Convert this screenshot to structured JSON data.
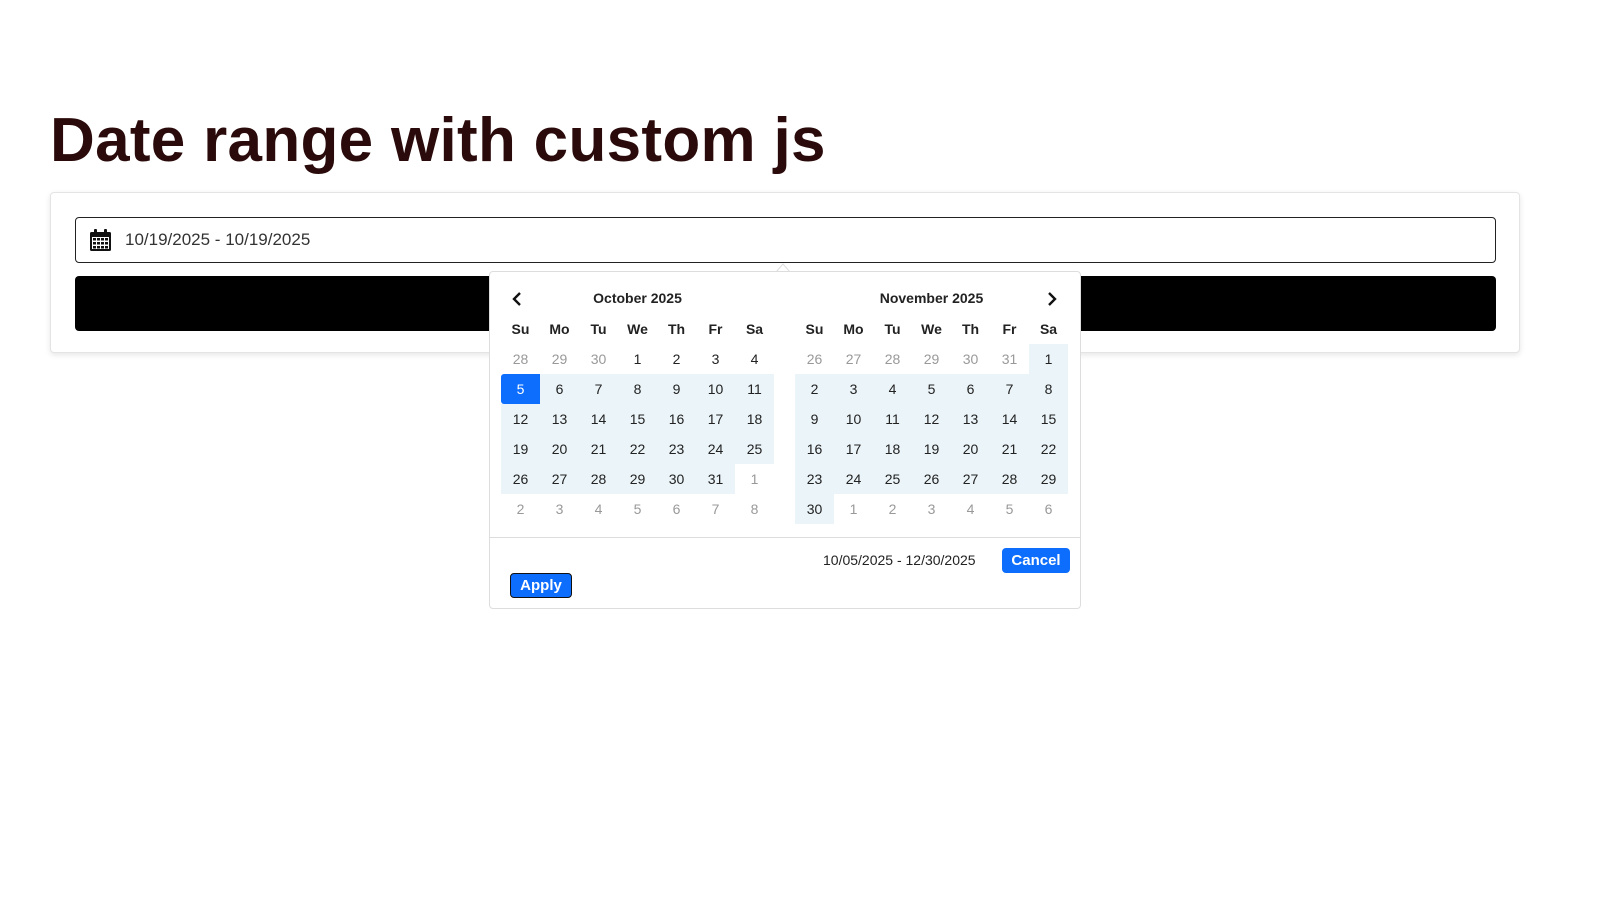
{
  "page": {
    "title": "Date range with custom js"
  },
  "input": {
    "value": "10/19/2025 - 10/19/2025",
    "icon": "calendar-icon"
  },
  "picker": {
    "prev_icon": "chevron-left-icon",
    "next_icon": "chevron-right-icon",
    "weekdays": [
      "Su",
      "Mo",
      "Tu",
      "We",
      "Th",
      "Fr",
      "Sa"
    ],
    "months": [
      {
        "title": "October 2025",
        "days": [
          {
            "d": "28",
            "off": true
          },
          {
            "d": "29",
            "off": true
          },
          {
            "d": "30",
            "off": true
          },
          {
            "d": "1"
          },
          {
            "d": "2"
          },
          {
            "d": "3"
          },
          {
            "d": "4"
          },
          {
            "d": "5",
            "active": true
          },
          {
            "d": "6",
            "range": true
          },
          {
            "d": "7",
            "range": true
          },
          {
            "d": "8",
            "range": true
          },
          {
            "d": "9",
            "range": true
          },
          {
            "d": "10",
            "range": true
          },
          {
            "d": "11",
            "range": true
          },
          {
            "d": "12",
            "range": true
          },
          {
            "d": "13",
            "range": true
          },
          {
            "d": "14",
            "range": true
          },
          {
            "d": "15",
            "range": true
          },
          {
            "d": "16",
            "range": true
          },
          {
            "d": "17",
            "range": true
          },
          {
            "d": "18",
            "range": true
          },
          {
            "d": "19",
            "range": true
          },
          {
            "d": "20",
            "range": true
          },
          {
            "d": "21",
            "range": true
          },
          {
            "d": "22",
            "range": true
          },
          {
            "d": "23",
            "range": true
          },
          {
            "d": "24",
            "range": true
          },
          {
            "d": "25",
            "range": true
          },
          {
            "d": "26",
            "range": true
          },
          {
            "d": "27",
            "range": true
          },
          {
            "d": "28",
            "range": true
          },
          {
            "d": "29",
            "range": true
          },
          {
            "d": "30",
            "range": true
          },
          {
            "d": "31",
            "range": true
          },
          {
            "d": "1",
            "off": true
          },
          {
            "d": "2",
            "off": true
          },
          {
            "d": "3",
            "off": true
          },
          {
            "d": "4",
            "off": true
          },
          {
            "d": "5",
            "off": true
          },
          {
            "d": "6",
            "off": true
          },
          {
            "d": "7",
            "off": true
          },
          {
            "d": "8",
            "off": true
          }
        ]
      },
      {
        "title": "November 2025",
        "days": [
          {
            "d": "26",
            "off": true
          },
          {
            "d": "27",
            "off": true
          },
          {
            "d": "28",
            "off": true
          },
          {
            "d": "29",
            "off": true
          },
          {
            "d": "30",
            "off": true
          },
          {
            "d": "31",
            "off": true
          },
          {
            "d": "1",
            "range": true
          },
          {
            "d": "2",
            "range": true
          },
          {
            "d": "3",
            "range": true
          },
          {
            "d": "4",
            "range": true
          },
          {
            "d": "5",
            "range": true
          },
          {
            "d": "6",
            "range": true
          },
          {
            "d": "7",
            "range": true
          },
          {
            "d": "8",
            "range": true
          },
          {
            "d": "9",
            "range": true
          },
          {
            "d": "10",
            "range": true
          },
          {
            "d": "11",
            "range": true
          },
          {
            "d": "12",
            "range": true
          },
          {
            "d": "13",
            "range": true
          },
          {
            "d": "14",
            "range": true
          },
          {
            "d": "15",
            "range": true
          },
          {
            "d": "16",
            "range": true
          },
          {
            "d": "17",
            "range": true
          },
          {
            "d": "18",
            "range": true
          },
          {
            "d": "19",
            "range": true
          },
          {
            "d": "20",
            "range": true
          },
          {
            "d": "21",
            "range": true
          },
          {
            "d": "22",
            "range": true
          },
          {
            "d": "23",
            "range": true
          },
          {
            "d": "24",
            "range": true
          },
          {
            "d": "25",
            "range": true
          },
          {
            "d": "26",
            "range": true
          },
          {
            "d": "27",
            "range": true
          },
          {
            "d": "28",
            "range": true
          },
          {
            "d": "29",
            "range": true
          },
          {
            "d": "30",
            "range": true
          },
          {
            "d": "1",
            "off": true
          },
          {
            "d": "2",
            "off": true
          },
          {
            "d": "3",
            "off": true
          },
          {
            "d": "4",
            "off": true
          },
          {
            "d": "5",
            "off": true
          },
          {
            "d": "6",
            "off": true
          }
        ]
      }
    ],
    "selected_range": "10/05/2025 - 12/30/2025",
    "cancel_label": "Cancel",
    "apply_label": "Apply"
  },
  "colors": {
    "accent": "#0d6efd",
    "range_bg": "#ebf4f8",
    "title": "#2a0a0a"
  }
}
